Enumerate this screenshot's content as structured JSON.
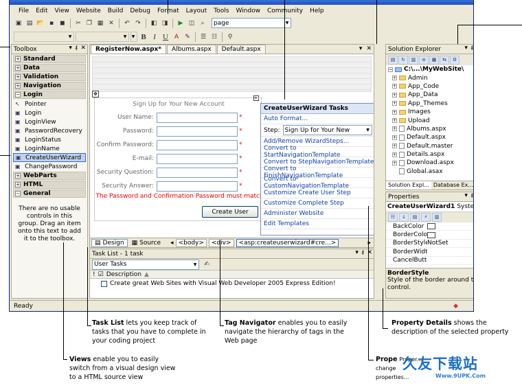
{
  "menubar": [
    "File",
    "Edit",
    "View",
    "Website",
    "Build",
    "Debug",
    "Format",
    "Layout",
    "Tools",
    "Window",
    "Community",
    "Help"
  ],
  "toolbar": {
    "page_combo": "page"
  },
  "toolbox": {
    "title": "Toolbox",
    "groups_top": [
      "Standard",
      "Data",
      "Validation",
      "Navigation",
      "Login"
    ],
    "login_items": [
      "Pointer",
      "Login",
      "LoginView",
      "PasswordRecovery",
      "LoginStatus",
      "LoginName",
      "CreateUserWizard",
      "ChangePassword"
    ],
    "groups_bottom": [
      "WebParts",
      "HTML",
      "General"
    ],
    "empty_text": "There are no usable controls in this group. Drag an item onto this text to add it to the toolbox."
  },
  "editor": {
    "tabs": [
      "RegisterNow.aspx*",
      "Albums.aspx",
      "Default.aspx"
    ],
    "wizard": {
      "title": "Sign Up for Your New Account",
      "fields": [
        "User Name:",
        "Password:",
        "Confirm Password:",
        "E-mail:",
        "Security Question:",
        "Security Answer:"
      ],
      "error": "The Password and Confirmation Password must match.",
      "button": "Create User"
    },
    "tasks": {
      "title": "CreateUserWizard Tasks",
      "auto_format": "Auto Format...",
      "step_label": "Step:",
      "step_value": "Sign Up for Your New",
      "links": [
        "Add/Remove WizardSteps...",
        "Convert to StartNavigationTemplate",
        "Convert to StepNavigationTemplate",
        "Convert to FinishNavigationTemplate",
        "Convert to CustomNavigationTemplate",
        "Customize Create User Step",
        "Customize Complete Step",
        "Administer Website",
        "Edit Templates"
      ]
    },
    "views": {
      "design": "Design",
      "source": "Source"
    },
    "tags": [
      "<body>",
      "<div>",
      "<asp:createuserwizard#cre...>"
    ]
  },
  "tasklist": {
    "title": "Task List - 1 task",
    "filter": "User Tasks",
    "col_description": "Description",
    "row": "Create great Web Sites with Visual Web Developer 2005 Express Edition!"
  },
  "solex": {
    "title": "Solution Explorer",
    "root": "C:\\...\\MyWebSite\\",
    "folders": [
      "Admin",
      "App_Code",
      "App_Data",
      "App_Themes",
      "Images",
      "Upload"
    ],
    "files": [
      "Albums.aspx",
      "Default.aspx",
      "Default.master",
      "Details.aspx",
      "Download.aspx",
      "Global.asax"
    ],
    "tabs": [
      "Solution Expl...",
      "Database Ex..."
    ]
  },
  "props": {
    "title": "Properties",
    "object": "CreateUserWizard1",
    "object_type": "System.We",
    "rows": [
      {
        "name": "BackColor",
        "value": ""
      },
      {
        "name": "BorderColor",
        "value": ""
      },
      {
        "name": "BorderStyle",
        "value": "NotSet"
      },
      {
        "name": "BorderWidth",
        "value": ""
      },
      {
        "name": "CancelButtonI",
        "value": ""
      }
    ],
    "desc_title": "BorderStyle",
    "desc_text": "Style of the border around the control."
  },
  "status": "Ready",
  "callouts": {
    "tasklist_b": "Task List",
    "tasklist_t": "lets you keep track of tasks that you have to complete in your coding project",
    "tagnav_b": "Tag Navigator",
    "tagnav_t": "enables you to easily navigate the hierarchy of tags in the Web page",
    "propdetails_b": "Property Details",
    "propdetails_t": "shows the description of the selected property",
    "views_b": "Views",
    "views_t": "enable you to easily switch from a visual design view to a HTML source view",
    "props_b": "Prope",
    "props_t": "Proper... change properties...",
    "watermark": "久友下载站",
    "watermark_sub": "Www.9UPK.Com"
  },
  "colors": {
    "link": "#0b3fa7",
    "error": "#e00000",
    "titlebar": "#1c4fc0"
  }
}
